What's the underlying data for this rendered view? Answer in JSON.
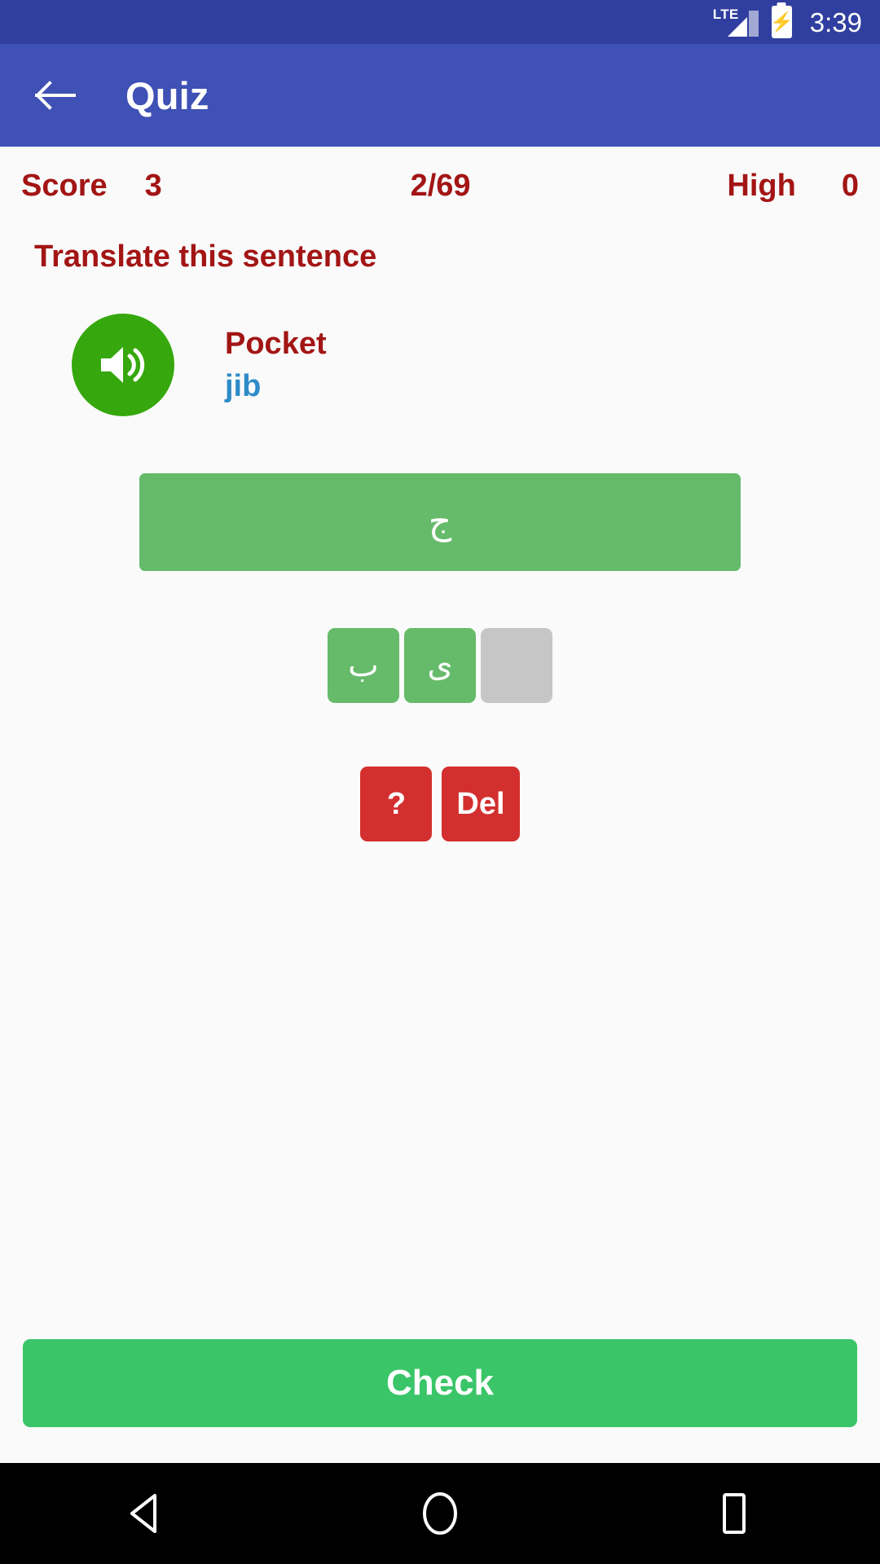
{
  "status_bar": {
    "network_label": "LTE",
    "signal_icon": "signal-bars-icon",
    "battery_icon": "battery-charging-icon",
    "time": "3:39",
    "background_color": "#303f9f"
  },
  "app_bar": {
    "back_icon": "back-arrow-icon",
    "title": "Quiz",
    "background_color": "#3f51b5"
  },
  "score_row": {
    "score_label": "Score",
    "score_value": "3",
    "progress": "2/69",
    "high_label": "High",
    "high_value": "0",
    "text_color": "#a31515"
  },
  "prompt": {
    "text": "Translate this sentence"
  },
  "question": {
    "speaker_icon": "speaker-volume-icon",
    "speaker_color": "#36a80e",
    "english_word": "Pocket",
    "transliteration": "jib",
    "english_color": "#a31515",
    "transliteration_color": "#2e8bc7"
  },
  "answer": {
    "text": "ج",
    "background_color": "#66bb6a"
  },
  "tiles": [
    {
      "label": "ب",
      "state": "filled"
    },
    {
      "label": "ى",
      "state": "filled"
    },
    {
      "label": "",
      "state": "empty"
    }
  ],
  "actions": [
    {
      "label": "?",
      "name": "hint-button"
    },
    {
      "label": "Del",
      "name": "delete-button"
    }
  ],
  "check": {
    "label": "Check",
    "background_color": "#3ac569"
  },
  "nav_bar": {
    "back_icon": "nav-back-triangle-icon",
    "home_icon": "nav-home-circle-icon",
    "recents_icon": "nav-recents-square-icon"
  }
}
